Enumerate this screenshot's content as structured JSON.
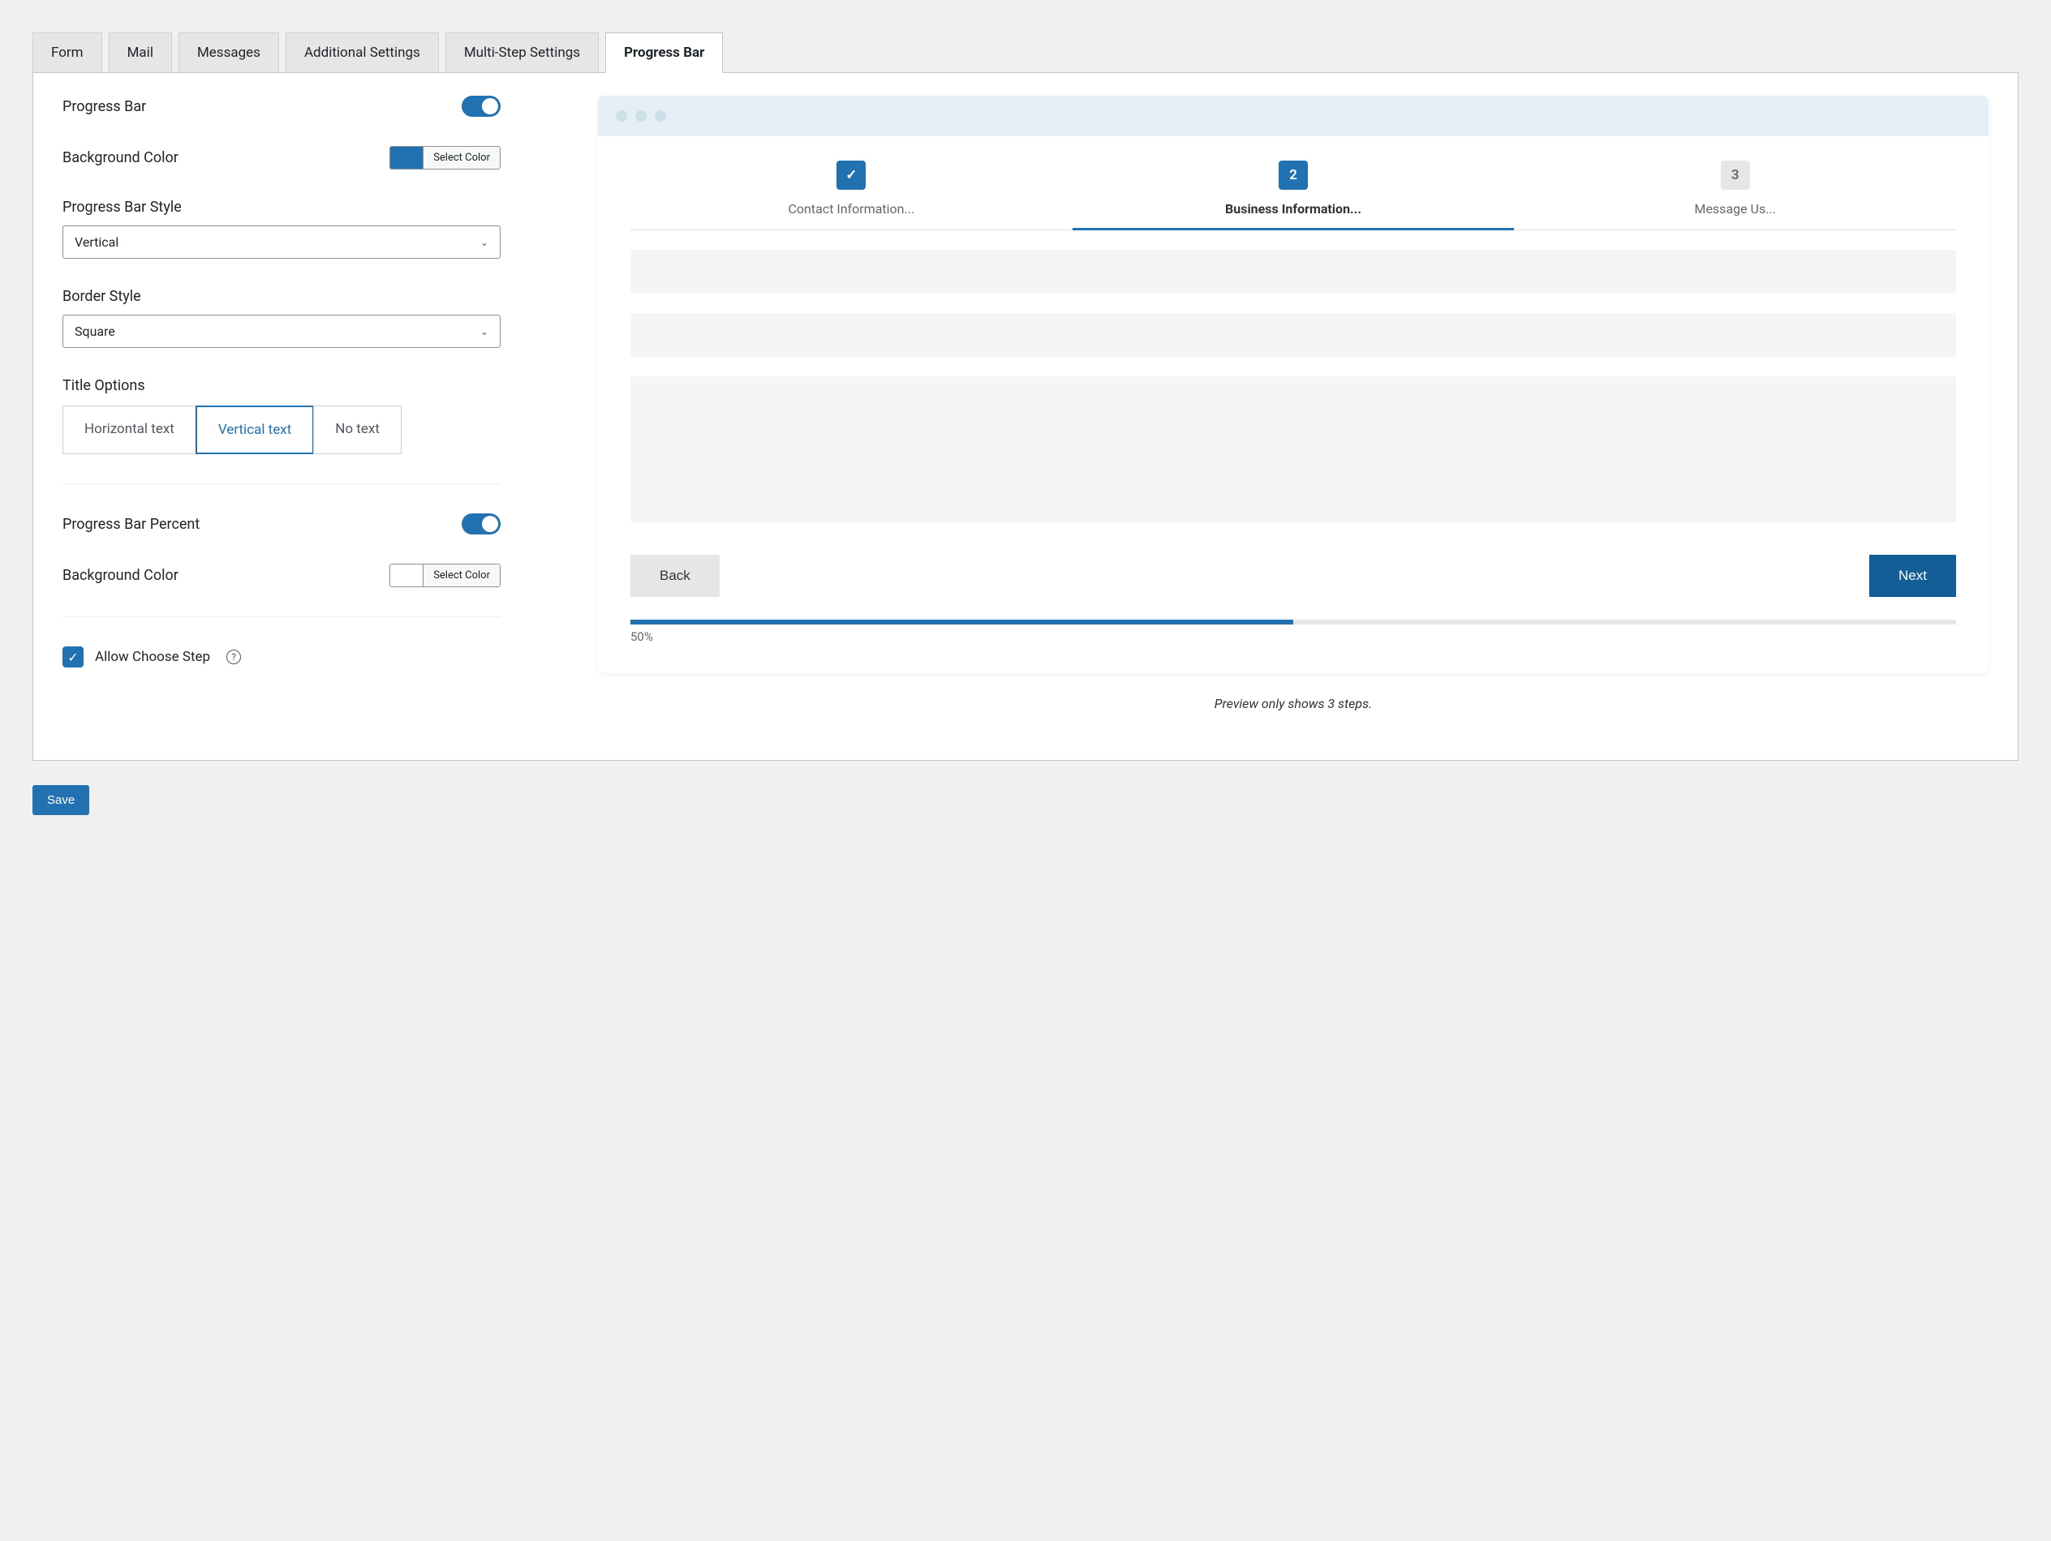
{
  "tabs": {
    "form": "Form",
    "mail": "Mail",
    "messages": "Messages",
    "additional": "Additional Settings",
    "multistep": "Multi-Step Settings",
    "progressbar": "Progress Bar"
  },
  "settings": {
    "progress_bar_label": "Progress Bar",
    "bg_color_label": "Background Color",
    "select_color_btn": "Select Color",
    "style_label": "Progress Bar Style",
    "style_value": "Vertical",
    "border_label": "Border Style",
    "border_value": "Square",
    "title_options_label": "Title Options",
    "title_opt_horizontal": "Horizontal text",
    "title_opt_vertical": "Vertical text",
    "title_opt_none": "No text",
    "percent_label": "Progress Bar Percent",
    "bg_color2_label": "Background Color",
    "select_color_btn2": "Select Color",
    "allow_choose_step": "Allow Choose Step"
  },
  "preview": {
    "step1_title": "Contact Information...",
    "step2_title": "Business Information...",
    "step3_title": "Message Us...",
    "step2_num": "2",
    "step3_num": "3",
    "back_btn": "Back",
    "next_btn": "Next",
    "percent": "50%",
    "note": "Preview only shows 3 steps."
  },
  "save_btn": "Save"
}
